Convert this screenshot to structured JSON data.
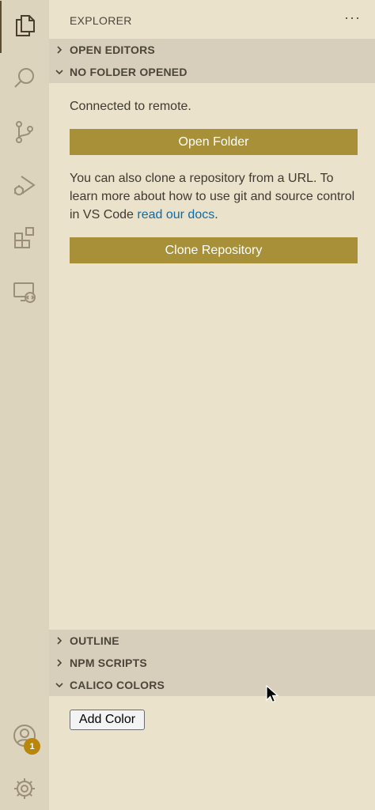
{
  "sidebar": {
    "title": "EXPLORER",
    "more_actions": "···",
    "sections": {
      "open_editors": "OPEN EDITORS",
      "no_folder": "NO FOLDER OPENED",
      "outline": "OUTLINE",
      "npm_scripts": "NPM SCRIPTS",
      "calico_colors": "CALICO COLORS"
    },
    "welcome": {
      "connected": "Connected to remote.",
      "open_folder_label": "Open Folder",
      "clone_text_1": "You can also clone a repository from a URL. To learn more about how to use git and source control in VS Code ",
      "clone_link": "read our docs",
      "clone_text_2": ".",
      "clone_button_label": "Clone Repository"
    },
    "calico": {
      "add_color_label": "Add Color"
    }
  },
  "activity_bar": {
    "items": [
      {
        "icon": "files-icon",
        "active": true
      },
      {
        "icon": "search-icon",
        "active": false
      },
      {
        "icon": "source-control-icon",
        "active": false
      },
      {
        "icon": "run-debug-icon",
        "active": false
      },
      {
        "icon": "extensions-icon",
        "active": false
      },
      {
        "icon": "remote-explorer-icon",
        "active": false
      }
    ],
    "accounts_badge": "1"
  },
  "colors": {
    "accent": "#a89039",
    "badge": "#b8860b",
    "link": "#0e6ba8",
    "sidebar_bg": "#ebe2cb",
    "activity_bg": "#ddd4bd"
  }
}
